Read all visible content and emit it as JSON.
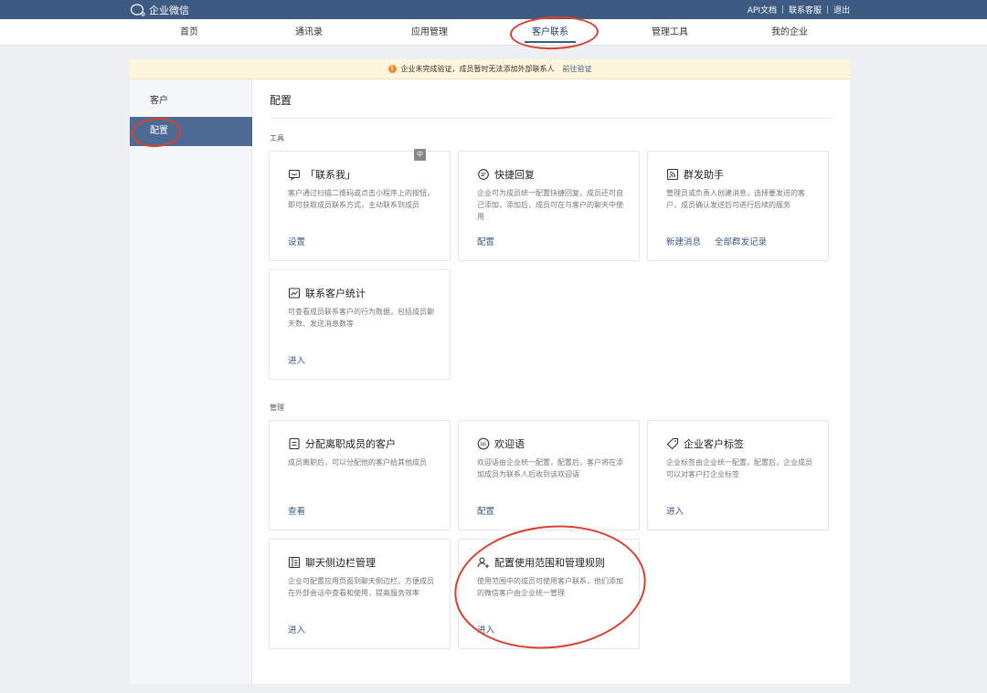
{
  "app": {
    "name": "企业微信",
    "logo_icon": "wecom-logo-icon"
  },
  "top_links": [
    "API文档",
    "联系客服",
    "退出"
  ],
  "nav": [
    "首页",
    "通讯录",
    "应用管理",
    "客户联系",
    "管理工具",
    "我的企业"
  ],
  "notice": {
    "text": "企业未完成验证，成员暂时无法添加外部联系人",
    "link": "前往验证",
    "icon": "warning-icon"
  },
  "sidebar": [
    "客户",
    "配置"
  ],
  "page_title": "配置",
  "sections": {
    "tools": "工具",
    "manage": "管理"
  },
  "badge_zh": "中",
  "cards": [
    {
      "title": "「联系我」",
      "icon": "contact-me-icon",
      "desc": "客户通过扫描二维码或点击小程序上的按钮，即可获取成员联系方式，主动联系到成员",
      "actions": [
        "设置"
      ]
    },
    {
      "title": "快捷回复",
      "icon": "quick-reply-icon",
      "desc": "企业可为成员统一配置快捷回复，成员还可自己添加，添加后，成员可在与客户的聊天中使用",
      "actions": [
        "配置"
      ]
    },
    {
      "title": "群发助手",
      "icon": "broadcast-icon",
      "desc": "管理员或负责人创建消息，选择要发送的客户，成员确认发送后可进行后续的服务",
      "actions": [
        "新建消息",
        "全部群发记录"
      ]
    },
    {
      "title": "联系客户统计",
      "icon": "statistics-chart-icon",
      "desc": "可查看成员联系客户的行为数据，包括成员聊天数、发送消息数等",
      "actions": [
        "进入"
      ]
    },
    {
      "title": "分配离职成员的客户",
      "icon": "assign-document-icon",
      "desc": "成员离职后，可以分配他的客户给其他成员",
      "actions": [
        "查看"
      ]
    },
    {
      "title": "欢迎语",
      "icon": "welcome-hi-icon",
      "desc": "欢迎语由企业统一配置，配置后，客户将在添加成员为联系人后收到该欢迎语",
      "actions": [
        "配置"
      ]
    },
    {
      "title": "企业客户标签",
      "icon": "tag-icon",
      "desc": "企业标签由企业统一配置，配置后，企业成员可以对客户打企业标签",
      "actions": [
        "进入"
      ]
    },
    {
      "title": "聊天侧边栏管理",
      "icon": "sidebar-panel-icon",
      "desc": "企业可配置应用页面到聊天侧边栏，方便成员在外部会话中查看和使用，提高服务效率",
      "actions": [
        "进入"
      ]
    },
    {
      "title": "配置使用范围和管理规则",
      "icon": "user-add-icon",
      "desc": "使用范围中的成员可使用客户联系，他们添加的微信客户由企业统一管理",
      "actions": [
        "进入"
      ]
    }
  ],
  "colors": {
    "topbar": "#3d5a82",
    "link": "#3d5a82",
    "sidebar_active": "#4d6a94",
    "notice_bg": "#fdf5dc",
    "annotation": "#d8412f"
  }
}
